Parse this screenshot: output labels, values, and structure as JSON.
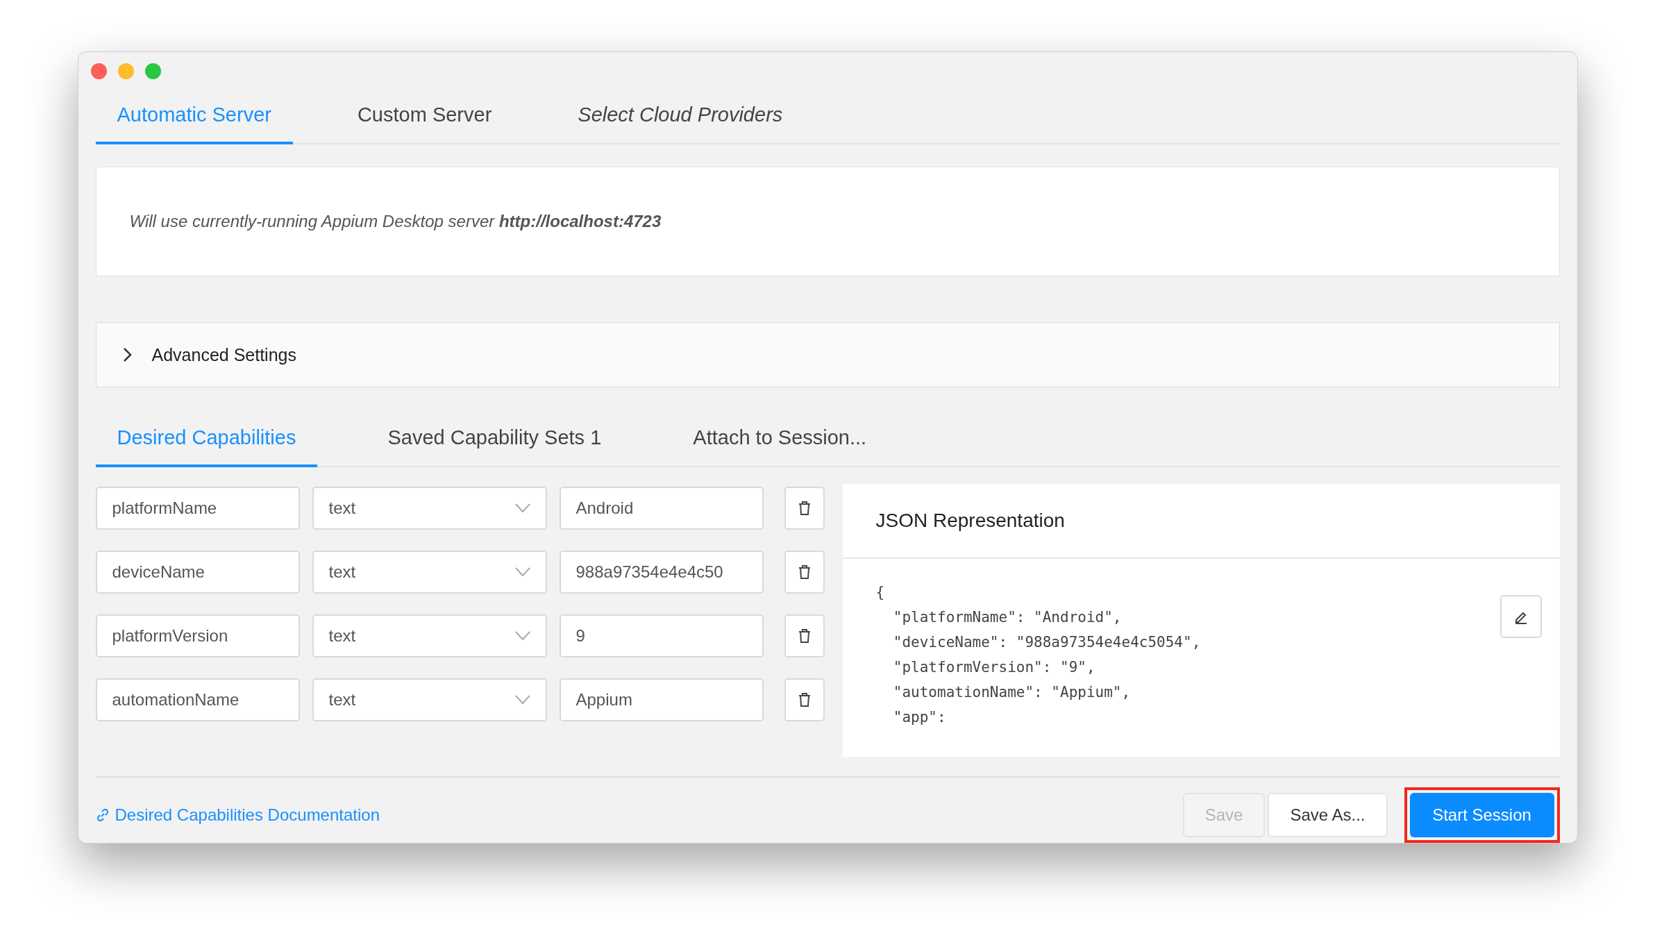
{
  "server_tabs": [
    {
      "label": "Automatic Server",
      "selected": true,
      "italic": false
    },
    {
      "label": "Custom Server",
      "selected": false,
      "italic": false
    },
    {
      "label": "Select Cloud Providers",
      "selected": false,
      "italic": true
    }
  ],
  "server_info": "Will use currently-running Appium Desktop server **http://localhost:4723**",
  "advanced_settings": {
    "label": "Advanced Settings",
    "expanded": false
  },
  "capability_tabs": [
    {
      "label": "Desired Capabilities",
      "selected": true
    },
    {
      "label": "Saved Capability Sets 1",
      "selected": false
    },
    {
      "label": "Attach to Session...",
      "selected": false
    }
  ],
  "capabilities": [
    {
      "name": "platformName",
      "type": "text",
      "value": "Android"
    },
    {
      "name": "deviceName",
      "type": "text",
      "value": "988a97354e4e4c50"
    },
    {
      "name": "platformVersion",
      "type": "text",
      "value": "9"
    },
    {
      "name": "automationName",
      "type": "text",
      "value": "Appium"
    }
  ],
  "json_panel": {
    "title": "JSON Representation",
    "lines": [
      "{",
      "  \"platformName\": \"Android\",",
      "  \"deviceName\": \"988a97354e4e4c5054\",",
      "  \"platformVersion\": \"9\",",
      "  \"automationName\": \"Appium\",",
      "  \"app\":"
    ]
  },
  "docs_link": "Desired Capabilities Documentation",
  "buttons": [
    {
      "label": "Save",
      "disabled": true,
      "kind": "default",
      "highlighted": false
    },
    {
      "label": "Save As...",
      "disabled": false,
      "kind": "default",
      "highlighted": false
    },
    {
      "label": "Start Session",
      "disabled": false,
      "kind": "primary",
      "highlighted": true
    }
  ]
}
